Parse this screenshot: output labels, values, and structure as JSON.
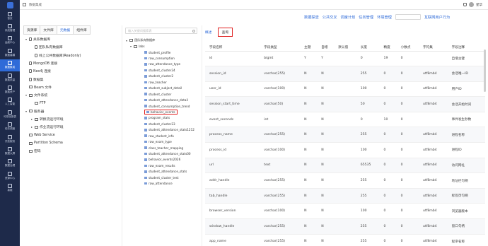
{
  "topbar": {
    "breadcrumb": "数据集成",
    "user": "星华"
  },
  "sidebar": {
    "items": [
      {
        "label": "首页"
      },
      {
        "label": "系统管理"
      },
      {
        "label": "运维中心"
      },
      {
        "label": "数据建模"
      },
      {
        "label": "数据集成"
      },
      {
        "label": "数据质量"
      },
      {
        "label": "数据资产"
      },
      {
        "label": "人工智能"
      },
      {
        "label": "可视化报表"
      },
      {
        "label": "任务调度"
      },
      {
        "label": "开放服务"
      },
      {
        "label": "数据大屏"
      },
      {
        "label": "数据治理"
      },
      {
        "label": "资源中心"
      },
      {
        "label": "易维"
      }
    ]
  },
  "links": [
    "数据探查",
    "公共交叉",
    "调度计划",
    "任务管理",
    "环境管理"
  ],
  "share": "互联网用户行为",
  "left_tabs": [
    "资源库",
    "文件库",
    "元数据",
    "组件库"
  ],
  "left_tree": [
    {
      "label": "关系数据库",
      "arrow": "▾",
      "indent": 0,
      "icon": "db"
    },
    {
      "label": "团队私有数据库",
      "arrow": "",
      "indent": 1,
      "icon": "db"
    },
    {
      "label": "线上公共数据库(Readonly)",
      "arrow": "",
      "indent": 1,
      "icon": "db"
    },
    {
      "label": "MongoDB 连接",
      "arrow": "",
      "indent": 0,
      "icon": "db"
    },
    {
      "label": "Neo4j 连接",
      "arrow": "",
      "indent": 0,
      "icon": "db"
    },
    {
      "label": "数据集",
      "arrow": "",
      "indent": 0,
      "icon": "db"
    },
    {
      "label": "Beam 文件",
      "arrow": "",
      "indent": 0,
      "icon": "folder"
    },
    {
      "label": "文件系统",
      "arrow": "▾",
      "indent": 0,
      "icon": "folder"
    },
    {
      "label": "FTP",
      "arrow": "",
      "indent": 1,
      "icon": "folder"
    },
    {
      "label": "服务器",
      "arrow": "▾",
      "indent": 0,
      "icon": "folder"
    },
    {
      "label": "转换流运行环境",
      "arrow": "▸",
      "indent": 1,
      "icon": "folder"
    },
    {
      "label": "作业流运行环境",
      "arrow": "▸",
      "indent": 1,
      "icon": "folder"
    },
    {
      "label": "Web Service",
      "arrow": "",
      "indent": 0,
      "icon": "folder"
    },
    {
      "label": "Partition Schema",
      "arrow": "",
      "indent": 0,
      "icon": "folder"
    },
    {
      "label": "密码",
      "arrow": "",
      "indent": 0,
      "icon": "folder"
    }
  ],
  "table_search": {
    "placeholder": "输入关键词搜索表"
  },
  "table_tree": {
    "root": "团队私有数据库",
    "schema": "labs",
    "tables": [
      "student_profile",
      "raw_consumption",
      "raw_attendance_type",
      "student_cluster24",
      "student_cluster2",
      "raw_teacher",
      "student_subject_detail",
      "student_cluster",
      "student_attendance_detail",
      "student_consumption_trend",
      "behavior_events",
      "program_stats",
      "student_cluster23",
      "student_attendance_stats1212",
      "raw_student_info",
      "raw_exam_type",
      "class_teacher_mapping",
      "student_attendance_stats00",
      "behavior_events2026",
      "raw_exam_results",
      "student_attendance_stats",
      "student_cluster_test",
      "raw_attendance"
    ],
    "selected": "behavior_events"
  },
  "detail_tabs": {
    "overview": "概述",
    "query": "查询"
  },
  "fields_table": {
    "headers": [
      "字段名称",
      "字段类型",
      "主键",
      "自增",
      "默认值",
      "长度",
      "精度",
      "小数点",
      "字符集",
      "字段注释"
    ],
    "rows": [
      [
        "id",
        "bigint",
        "Y",
        "Y",
        "",
        "0",
        "19",
        "0",
        "",
        "自增主键"
      ],
      [
        "session_id",
        "varchar(255)",
        "N",
        "N",
        "",
        "255",
        "0",
        "0",
        "utf8mb4",
        "会话唯一ID"
      ],
      [
        "user_id",
        "varchar(100)",
        "N",
        "N",
        "",
        "100",
        "0",
        "0",
        "utf8mb4",
        "用户ID"
      ],
      [
        "session_start_time",
        "varchar(50)",
        "N",
        "N",
        "",
        "50",
        "0",
        "0",
        "utf8mb4",
        "会话开始时间"
      ],
      [
        "event_seconds",
        "int",
        "N",
        "N",
        "",
        "0",
        "10",
        "0",
        "",
        "事件发生秒数"
      ],
      [
        "process_name",
        "varchar(255)",
        "N",
        "N",
        "",
        "255",
        "0",
        "0",
        "utf8mb4",
        "进程名称"
      ],
      [
        "process_id",
        "varchar(100)",
        "N",
        "N",
        "",
        "100",
        "0",
        "0",
        "utf8mb4",
        "进程ID"
      ],
      [
        "url",
        "text",
        "N",
        "N",
        "",
        "65535",
        "0",
        "0",
        "utf8mb4",
        "访问网址"
      ],
      [
        "addr_handle",
        "varchar(255)",
        "N",
        "N",
        "",
        "255",
        "0",
        "0",
        "utf8mb4",
        "地址栏句柄"
      ],
      [
        "tab_handle",
        "varchar(255)",
        "N",
        "N",
        "",
        "255",
        "0",
        "0",
        "utf8mb4",
        "标签页句柄"
      ],
      [
        "browser_version",
        "varchar(100)",
        "N",
        "N",
        "",
        "100",
        "0",
        "0",
        "utf8mb4",
        "浏览器版本"
      ],
      [
        "window_handle",
        "varchar(255)",
        "N",
        "N",
        "",
        "255",
        "0",
        "0",
        "utf8mb4",
        "窗口句柄"
      ],
      [
        "app_name",
        "varchar(255)",
        "N",
        "N",
        "",
        "255",
        "0",
        "0",
        "utf8mb4",
        "程序名称"
      ]
    ]
  },
  "colors": {
    "sidebar_bg": "#1e2a4a",
    "accent": "#2f6bd8",
    "highlight": "#e02020"
  }
}
